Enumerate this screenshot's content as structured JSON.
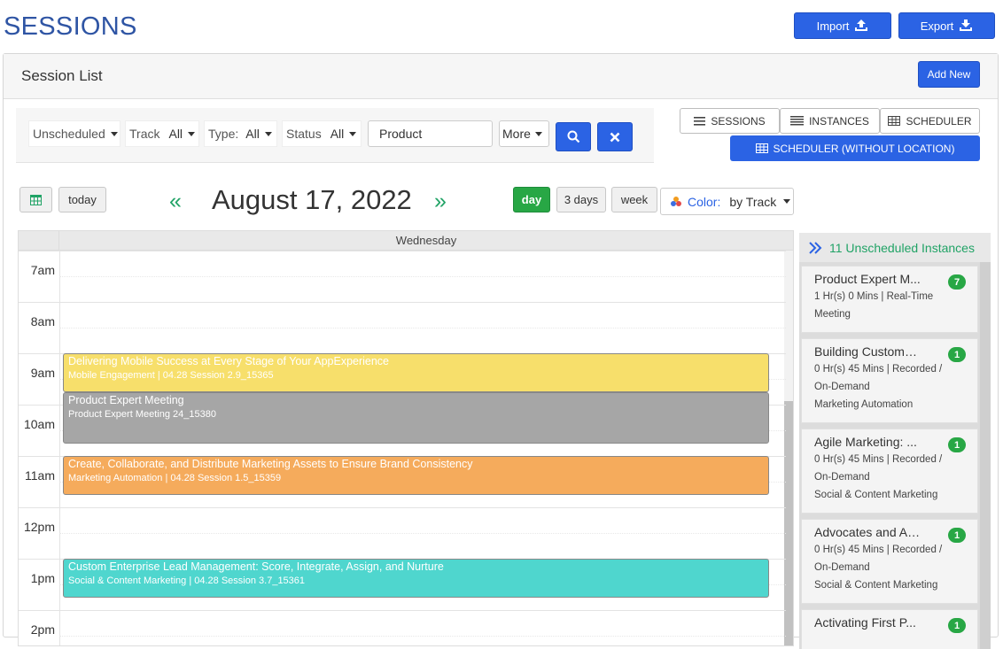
{
  "page_title": "SESSIONS",
  "header": {
    "import_label": "Import",
    "export_label": "Export"
  },
  "panel": {
    "title": "Session List",
    "add_new_label": "Add New"
  },
  "filters": {
    "scheduled": "Unscheduled",
    "track_label": "Track",
    "track_value": "All",
    "type_label": "Type:",
    "type_value": "All",
    "status_label": "Status",
    "status_value": "All",
    "search_value": "Product",
    "more_label": "More"
  },
  "view_tabs": {
    "sessions": "SESSIONS",
    "instances": "INSTANCES",
    "scheduler": "SCHEDULER",
    "scheduler_noloc": "SCHEDULER (WITHOUT LOCATION)"
  },
  "toolbar": {
    "today_label": "today",
    "date_title": "August 17, 2022",
    "prev_arrow": "«",
    "next_arrow": "»",
    "day_label": "day",
    "three_days_label": "3 days",
    "week_label": "week",
    "color_label": "Color:",
    "color_value": "by Track"
  },
  "calendar": {
    "day_header": "Wednesday",
    "times": [
      "7am",
      "8am",
      "9am",
      "10am",
      "11am",
      "12pm",
      "1pm",
      "2pm"
    ],
    "events": [
      {
        "title": "Delivering Mobile Success at Every Stage of Your AppExperience",
        "subtitle": "Mobile Engagement | 04.28 Session 2.9_15365",
        "color": "#f7df6b"
      },
      {
        "title": "Product Expert Meeting",
        "subtitle": "Product Expert Meeting 24_15380",
        "color": "#a6a6a6"
      },
      {
        "title": "Create, Collaborate, and Distribute Marketing Assets to Ensure Brand Consistency",
        "subtitle": "Marketing Automation | 04.28 Session 1.5_15359",
        "color": "#f5ab5c"
      },
      {
        "title": "Custom Enterprise Lead Management: Score, Integrate, Assign, and Nurture",
        "subtitle": "Social & Content Marketing | 04.28 Session 3.7_15361",
        "color": "#4fd6ce"
      }
    ]
  },
  "unscheduled": {
    "header": "11 Unscheduled Instances",
    "items": [
      {
        "title": "Product Expert M...",
        "badge": "7",
        "line1": "1 Hr(s) 0 Mins | Real-Time",
        "line2": "Meeting",
        "line3": ""
      },
      {
        "title": "Building Custome...",
        "badge": "1",
        "line1": "0 Hr(s) 45 Mins | Recorded /",
        "line2": "On-Demand",
        "line3": "Marketing Automation"
      },
      {
        "title": "Agile Marketing: ...",
        "badge": "1",
        "line1": "0 Hr(s) 45 Mins | Recorded /",
        "line2": "On-Demand",
        "line3": "Social & Content Marketing"
      },
      {
        "title": "Advocates and Ag...",
        "badge": "1",
        "line1": "0 Hr(s) 45 Mins | Recorded /",
        "line2": "On-Demand",
        "line3": "Social & Content Marketing"
      },
      {
        "title": "Activating First P...",
        "badge": "1",
        "line1": "",
        "line2": "",
        "line3": ""
      }
    ]
  },
  "colors": {
    "primary": "#2b63e4",
    "green": "#21a366",
    "title_blue": "#2f55a4"
  }
}
